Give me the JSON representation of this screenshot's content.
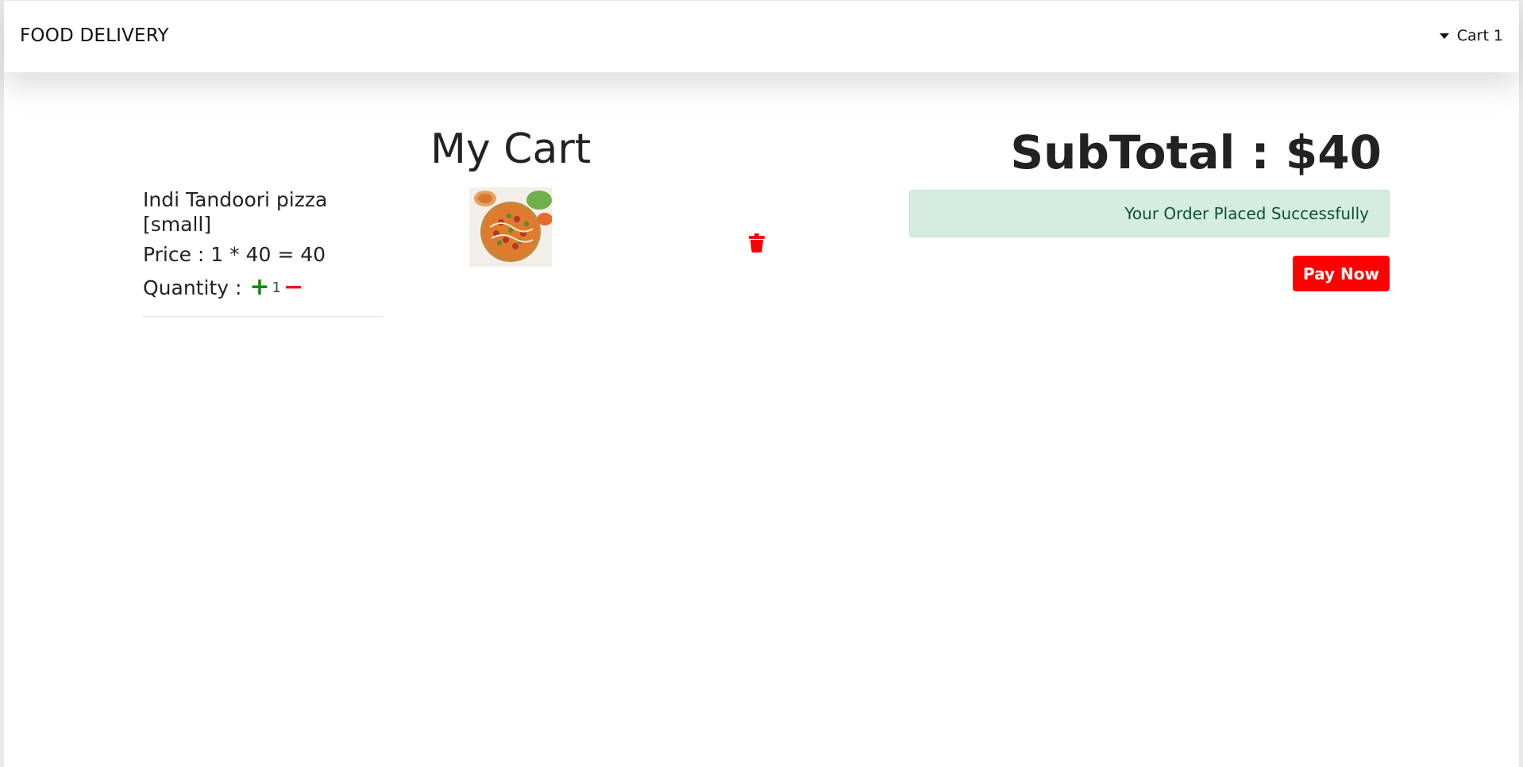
{
  "navbar": {
    "brand": "FOOD DELIVERY",
    "cart_label": "Cart",
    "cart_count": "1"
  },
  "cart": {
    "title": "My Cart",
    "items": [
      {
        "name": "Indi Tandoori pizza [small]",
        "price_text": "Price : 1 * 40 = 40",
        "quantity_label": "Quantity :",
        "quantity": "1",
        "image_icon": "pizza-image",
        "delete_icon": "trash-icon"
      }
    ]
  },
  "summary": {
    "subtotal": "SubTotal : $40",
    "alert": "Your Order Placed Successfully",
    "pay_label": "Pay Now"
  },
  "colors": {
    "accent_red": "#ff0000",
    "plus_green": "#0b8a0b",
    "alert_bg": "#d4ede0",
    "alert_text": "#0f5132"
  }
}
